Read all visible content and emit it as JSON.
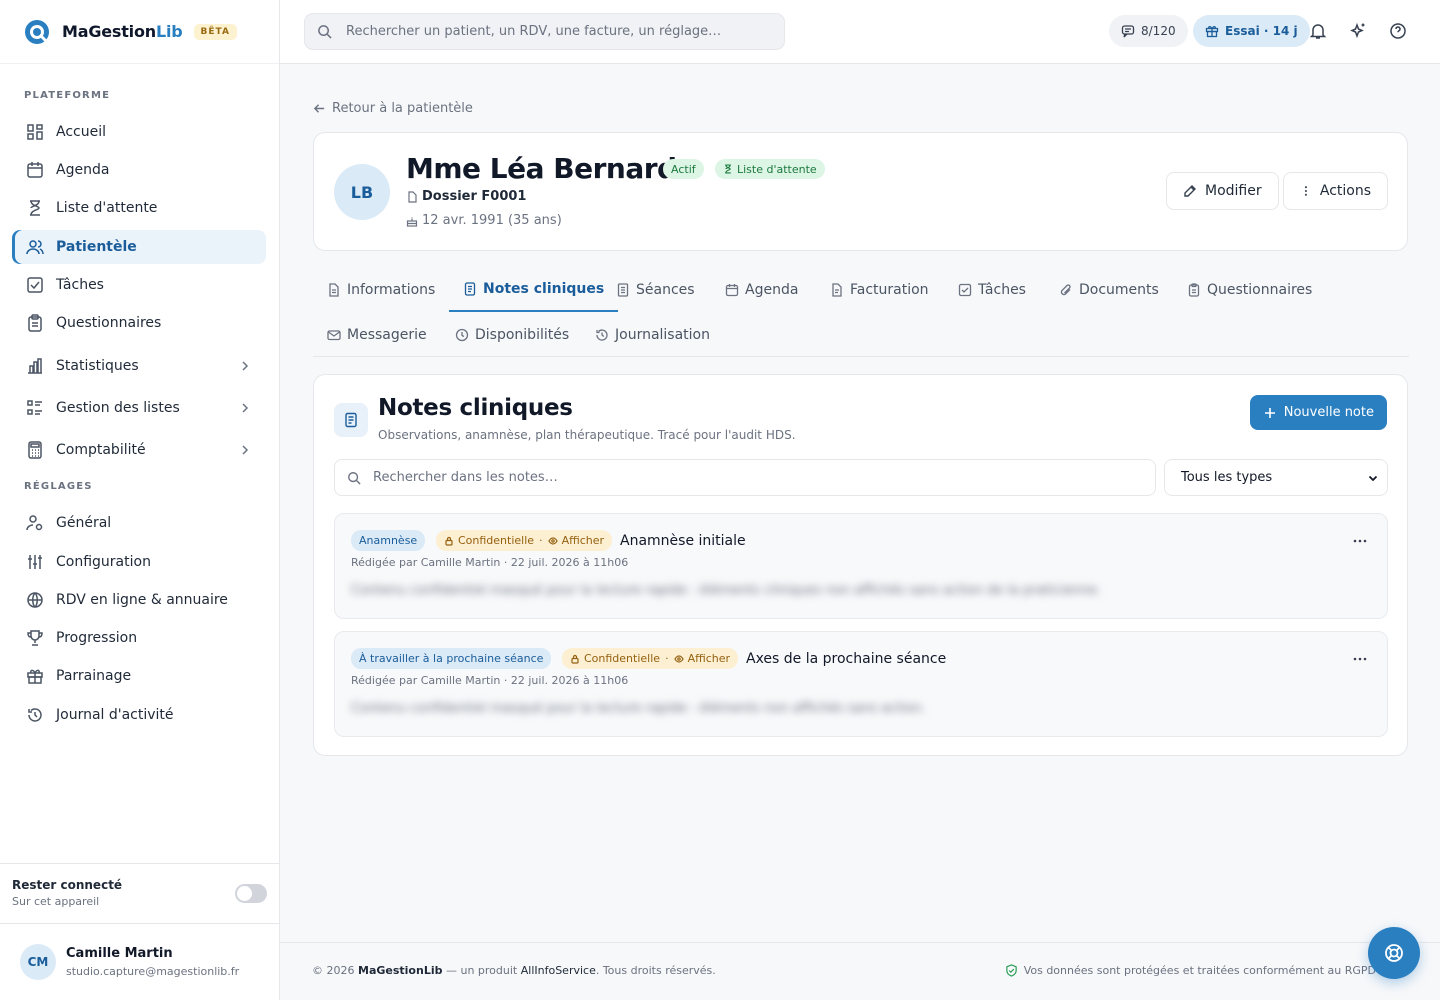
{
  "brand": {
    "name_main": "MaGestion",
    "name_accent": "Lib",
    "badge": "BÊTA"
  },
  "sidebar": {
    "section_platform": "PLATEFORME",
    "section_settings": "RÉGLAGES",
    "platform_items": [
      {
        "label": "Accueil",
        "icon": "grid-icon"
      },
      {
        "label": "Agenda",
        "icon": "calendar-icon"
      },
      {
        "label": "Liste d'attente",
        "icon": "hourglass-icon"
      },
      {
        "label": "Patientèle",
        "icon": "users-icon",
        "active": true
      },
      {
        "label": "Tâches",
        "icon": "checkbox-icon"
      },
      {
        "label": "Questionnaires",
        "icon": "clipboard-icon"
      },
      {
        "label": "Statistiques",
        "icon": "bar-chart-icon",
        "expandable": true
      },
      {
        "label": "Gestion des listes",
        "icon": "list-icon",
        "expandable": true
      },
      {
        "label": "Comptabilité",
        "icon": "calculator-icon",
        "expandable": true
      }
    ],
    "settings_items": [
      {
        "label": "Général",
        "icon": "user-gear-icon"
      },
      {
        "label": "Configuration",
        "icon": "sliders-icon"
      },
      {
        "label": "RDV en ligne & annuaire",
        "icon": "globe-icon"
      },
      {
        "label": "Progression",
        "icon": "trophy-icon"
      },
      {
        "label": "Parrainage",
        "icon": "gift-icon"
      },
      {
        "label": "Journal d'activité",
        "icon": "history-icon"
      }
    ],
    "stay_connected": {
      "title": "Rester connecté",
      "subtitle": "Sur cet appareil",
      "enabled": false
    },
    "user": {
      "initials": "CM",
      "name": "Camille Martin",
      "email": "studio.capture@magestionlib.fr"
    }
  },
  "topbar": {
    "search_placeholder": "Rechercher un patient, un RDV, une facture, un réglage…",
    "sms_count": "8/120",
    "trial_label": "Essai · 14 j"
  },
  "patient": {
    "back_label": "Retour à la patientèle",
    "initials": "LB",
    "name": "Mme Léa Bernard",
    "status_badge": "Actif",
    "waitlist_badge": "Liste d'attente",
    "dossier": "Dossier F0001",
    "birth": "12 avr. 1991 (35 ans)",
    "edit_label": "Modifier",
    "actions_label": "Actions"
  },
  "tabs": [
    {
      "label": "Informations",
      "icon": "file-icon"
    },
    {
      "label": "Notes cliniques",
      "icon": "notes-icon",
      "active": true
    },
    {
      "label": "Séances",
      "icon": "file-list-icon"
    },
    {
      "label": "Agenda",
      "icon": "calendar-icon"
    },
    {
      "label": "Facturation",
      "icon": "invoice-icon"
    },
    {
      "label": "Tâches",
      "icon": "checkbox-icon"
    },
    {
      "label": "Documents",
      "icon": "paperclip-icon"
    },
    {
      "label": "Questionnaires",
      "icon": "clipboard-icon"
    },
    {
      "label": "Messagerie",
      "icon": "mail-icon"
    },
    {
      "label": "Disponibilités",
      "icon": "clock-icon"
    },
    {
      "label": "Journalisation",
      "icon": "history-icon"
    }
  ],
  "notes": {
    "title": "Notes cliniques",
    "subtitle": "Observations, anamnèse, plan thérapeutique. Tracé pour l'audit HDS.",
    "new_button": "Nouvelle note",
    "search_placeholder": "Rechercher dans les notes…",
    "filter_value": "Tous les types",
    "items": [
      {
        "type_badge": "Anamnèse",
        "confidential": "Confidentielle",
        "show": "Afficher",
        "title": "Anamnèse initiale",
        "meta": "Rédigée par Camille Martin · 22 juil. 2026 à 11h06",
        "preview": "Contenu confidentiel masqué pour la lecture rapide : éléments cliniques non affichés sans action de la praticienne."
      },
      {
        "type_badge": "À travailler à la prochaine séance",
        "confidential": "Confidentielle",
        "show": "Afficher",
        "title": "Axes de la prochaine séance",
        "meta": "Rédigée par Camille Martin · 22 juil. 2026 à 11h06",
        "preview": "Contenu confidentiel masqué pour la lecture rapide : éléments non affichés sans action."
      }
    ]
  },
  "footer": {
    "copyright_prefix": "© 2026 ",
    "brand": "MaGestionLib",
    "middle": " — un produit ",
    "company": "AllInfoService",
    "suffix": ". Tous droits réservés.",
    "security": "Vos données sont protégées et traitées conformément au RGPD"
  },
  "colors": {
    "accent": "#2a7fc1",
    "accent_dark": "#1a5d9a",
    "success": "#1c7a3f",
    "warning": "#946010"
  }
}
